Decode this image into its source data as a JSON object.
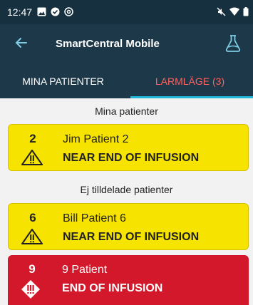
{
  "status_bar": {
    "time": "12:47",
    "left_icons": [
      "image-icon",
      "check-circle-icon",
      "at-sign-icon"
    ],
    "right_icons": [
      "mute-icon",
      "wifi-icon",
      "battery-icon"
    ]
  },
  "app_bar": {
    "title": "SmartCentral Mobile",
    "back_icon": "arrow-left-icon",
    "action_icon": "flask-icon"
  },
  "tabs": [
    {
      "label": "MINA PATIENTER",
      "active": false
    },
    {
      "label": "LARMLÄGE (3)",
      "active": true
    }
  ],
  "sections": [
    {
      "label": "Mina patienter",
      "cards": [
        {
          "number": "2",
          "name": "Jim Patient 2",
          "status": "NEAR END OF INFUSION",
          "severity": "warning",
          "icon": "warning-triangle-icon"
        }
      ]
    },
    {
      "label": "Ej tilldelade patienter",
      "cards": [
        {
          "number": "6",
          "name": "Bill Patient 6",
          "status": "NEAR END OF INFUSION",
          "severity": "warning",
          "icon": "warning-triangle-icon"
        },
        {
          "number": "9",
          "name": "9 Patient",
          "status": "END OF INFUSION",
          "severity": "alarm",
          "icon": "alarm-diamond-icon"
        }
      ]
    }
  ],
  "colors": {
    "status_bar": "#16303f",
    "app_bar": "#1d3848",
    "active_tab_text": "#ff6060",
    "tab_indicator": "#1fb8d8",
    "warning_card": "#f7e300",
    "alarm_card": "#d3182b",
    "background": "#f2f2f2"
  }
}
